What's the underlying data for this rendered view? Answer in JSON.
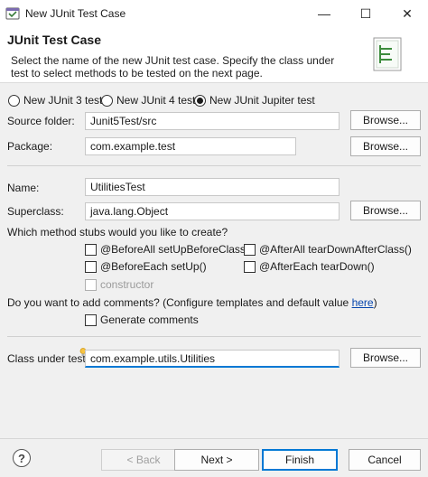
{
  "window": {
    "title": "New JUnit Test Case",
    "minimize_glyph": "—",
    "maximize_glyph": "☐",
    "close_glyph": "✕"
  },
  "header": {
    "title": "JUnit Test Case",
    "description": "Select the name of the new JUnit test case. Specify the class under test to select methods to be tested on the next page."
  },
  "junit_versions": [
    {
      "label": "New JUnit 3 test",
      "selected": false
    },
    {
      "label": "New JUnit 4 test",
      "selected": false
    },
    {
      "label": "New JUnit Jupiter test",
      "selected": true
    }
  ],
  "source_folder": {
    "label": "Source folder:",
    "value": "Junit5Test/src",
    "browse": "Browse..."
  },
  "package": {
    "label": "Package:",
    "value": "com.example.test",
    "browse": "Browse..."
  },
  "name": {
    "label": "Name:",
    "value": "UtilitiesTest"
  },
  "superclass": {
    "label": "Superclass:",
    "value": "java.lang.Object",
    "browse": "Browse..."
  },
  "stubs": {
    "question": "Which method stubs would you like to create?",
    "before_all": "@BeforeAll setUpBeforeClass()",
    "after_all": "@AfterAll tearDownAfterClass()",
    "before_each": "@BeforeEach setUp()",
    "after_each": "@AfterEach tearDown()",
    "constructor": "constructor"
  },
  "comments": {
    "question": "Do you want to add comments? (Configure templates and default value ",
    "link": "here",
    "close_paren": ")",
    "generate": "Generate comments"
  },
  "class_under_test": {
    "label": "Class under test:",
    "value": "com.example.utils.Utilities",
    "browse": "Browse..."
  },
  "footer": {
    "help": "?",
    "back": "< Back",
    "next": "Next >",
    "finish": "Finish",
    "cancel": "Cancel"
  }
}
